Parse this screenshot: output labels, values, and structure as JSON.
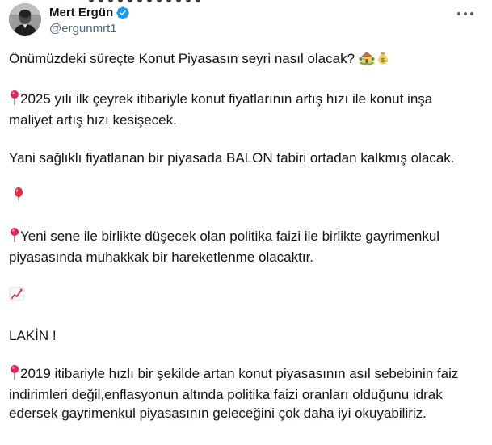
{
  "author": {
    "name": "Mert Ergün",
    "handle": "@ergunmrt1"
  },
  "icons": {
    "verified": "verified-badge-icon",
    "more": "more-options-icon",
    "house": "house-with-garden-icon",
    "money": "money-bag-icon",
    "pin": "round-pushpin-icon",
    "balloon": "balloon-icon",
    "chart": "chart-increasing-icon"
  },
  "colors": {
    "text": "#0f1419",
    "muted": "#536471",
    "verified": "#1d9bf0",
    "pin": "#e0245e"
  },
  "tweet": {
    "line1": "Önümüzdeki süreçte Konut Piyasasın seyri nasıl olacak?",
    "p2": "2025 yılı ilk çeyrek itibariyle konut fiyatlarının artış hızı ile konut inşa maliyet artış hızı kesişecek.",
    "p3": "Yani sağlıklı fiyatlanan bir piyasada BALON tabiri ortadan kalkmış olacak.",
    "p4": "Yeni sene ile birlikte düşecek olan politika faizi ile birlikte gayrimenkul piyasasında muhakkak bir hareketlenme olacaktır.",
    "p5": "LAKİN !",
    "p6": "2019 itibariyle hızlı bir şekilde artan konut piyasasının asıl sebebinin faiz indirimleri değil,enflasyonun altında politika faizi oranları olduğunu idrak edersek gayrimenkul piyasasının geleceğini çok daha iyi okuyabiliriz."
  }
}
